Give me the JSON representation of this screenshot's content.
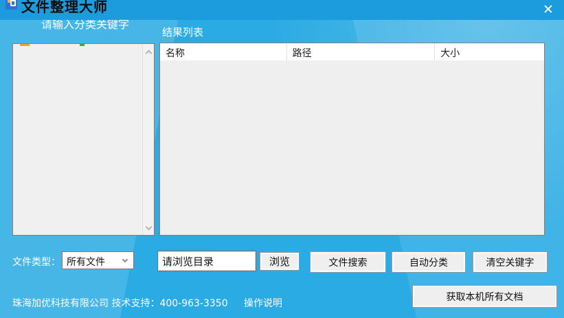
{
  "window": {
    "title": "文件整理大师",
    "close_glyph": "✕"
  },
  "left_panel": {
    "keyword_label": "请输入分类关键字"
  },
  "results": {
    "section_label": "结果列表",
    "columns": [
      "名称",
      "路径",
      "大小"
    ],
    "rows": []
  },
  "controls": {
    "file_type_label": "文件类型：",
    "file_type_value": "所有文件",
    "directory_input_value": "请浏览目录",
    "browse_button": "浏览",
    "search_button": "文件搜索",
    "classify_button": "自动分类",
    "clear_button": "清空关键字"
  },
  "footer": {
    "company_support": "珠海加优科技有限公司 技术支持：400-963-3350",
    "help_link": "操作说明",
    "get_all_docs_button": "获取本机所有文档"
  },
  "colors": {
    "titlebar": "#1d9cdd",
    "background": "#2babe3",
    "panel": "#efefef",
    "header_row": "#ffffff"
  }
}
